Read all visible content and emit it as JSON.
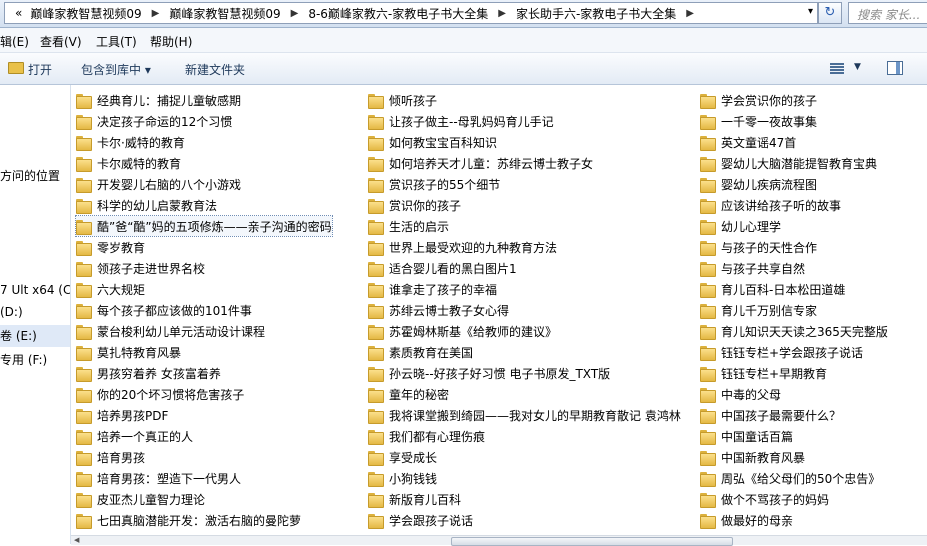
{
  "address": {
    "lead": "«",
    "crumbs": [
      "巅峰家教智慧视频09",
      "巅峰家教智慧视频09",
      "8-6巅峰家教六-家教电子书大全集",
      "家长助手六-家教电子书大全集"
    ],
    "separator": "▶",
    "dropdown": "▾"
  },
  "refresh_glyph": "↻",
  "search": {
    "placeholder": "搜索 家长..."
  },
  "menu": [
    "辑(E)",
    "查看(V)",
    "工具(T)",
    "帮助(H)"
  ],
  "toolbar": {
    "open": "打开",
    "include_library": "包含到库中 ▾",
    "new_folder": "新建文件夹",
    "views_dd": "▼"
  },
  "nav": {
    "items": [
      "方问的位置",
      "7 Ult x64 (C:",
      "(D:)",
      "卷 (E:)",
      "专用 (F:)"
    ]
  },
  "columns": [
    [
      "经典育儿：捕捉儿童敏感期",
      "决定孩子命运的12个习惯",
      "卡尔·威特的教育",
      "卡尔威特的教育",
      "开发婴儿右脑的八个小游戏",
      "科学的幼儿启蒙教育法",
      "酷”爸“酷”妈的五项修炼——亲子沟通的密码",
      "零岁教育",
      "领孩子走进世界名校",
      "六大规矩",
      "每个孩子都应该做的101件事",
      "蒙台梭利幼儿单元活动设计课程",
      "莫扎特教育风暴",
      "男孩穷着养 女孩富着养",
      "你的20个坏习惯将危害孩子",
      "培养男孩PDF",
      "培养一个真正的人",
      "培育男孩",
      "培育男孩：塑造下一代男人",
      "皮亚杰儿童智力理论",
      "七田真脑潜能开发：激活右脑的曼陀萝"
    ],
    [
      "倾听孩子",
      "让孩子做主--母乳妈妈育儿手记",
      "如何教宝宝百科知识",
      "如何培养天才儿童：苏绯云博士教子女",
      "赏识孩子的55个细节",
      "赏识你的孩子",
      "生活的启示",
      "世界上最受欢迎的九种教育方法",
      "适合婴儿看的黑白图片1",
      "谁拿走了孩子的幸福",
      "苏绯云博士教子女心得",
      "苏霍姆林斯基《给教师的建议》",
      "素质教育在美国",
      "孙云晓--好孩子好习惯 电子书原发_TXT版",
      "童年的秘密",
      "我将课堂搬到绮园——我对女儿的早期教育散记 袁鸿林",
      "我们都有心理伤痕",
      "享受成长",
      "小狗钱钱",
      "新版育儿百科",
      "学会跟孩子说话"
    ],
    [
      "学会赏识你的孩子",
      "一千零一夜故事集",
      "英文童谣47首",
      "婴幼儿大脑潜能提智教育宝典",
      "婴幼儿疾病流程图",
      "应该讲给孩子听的故事",
      "幼儿心理学",
      "与孩子的天性合作",
      "与孩子共享自然",
      "育儿百科-日本松田道雄",
      "育儿千万别信专家",
      "育儿知识天天读之365天完整版",
      "钰钰专栏+学会跟孩子说话",
      "钰钰专栏+早期教育",
      "中毒的父母",
      "中国孩子最需要什么？",
      "中国童话百篇",
      "中国新教育风暴",
      "周弘《给父母们的50个忠告》",
      "做个不骂孩子的妈妈",
      "做最好的母亲"
    ]
  ],
  "hscroll_glyph": "◀"
}
